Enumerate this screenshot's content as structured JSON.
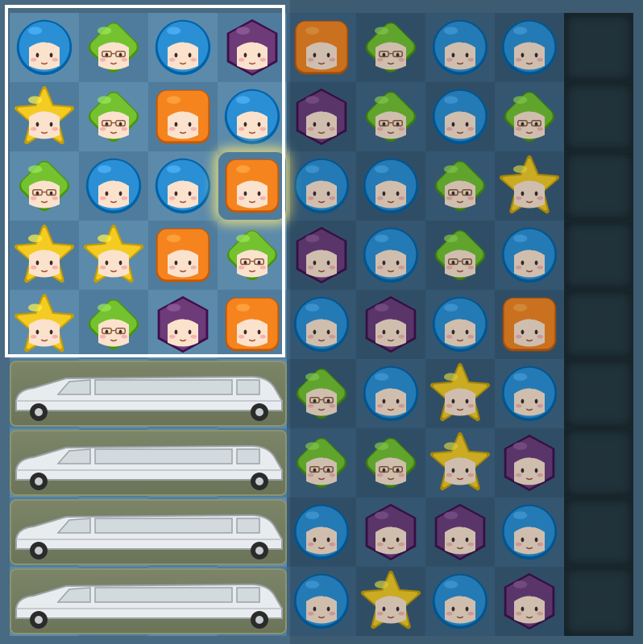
{
  "game": {
    "board": {
      "cols": 9,
      "rows": 9,
      "pieces": [
        [
          "blue",
          "green",
          "blue",
          "purple",
          "orange",
          "green",
          "blue",
          "blue",
          null
        ],
        [
          "yellow",
          "green",
          "orange",
          "blue",
          "purple",
          "green",
          "blue",
          "green",
          null
        ],
        [
          "green",
          "blue",
          "blue",
          "orange",
          "blue",
          "blue",
          "green",
          "yellow",
          null
        ],
        [
          "yellow",
          "yellow",
          "orange",
          "green",
          "purple",
          "blue",
          "green",
          "blue",
          null
        ],
        [
          "yellow",
          "green",
          "purple",
          "orange",
          "blue",
          "purple",
          "blue",
          "orange",
          null
        ],
        [
          null,
          null,
          null,
          null,
          "green",
          "blue",
          "yellow",
          "blue",
          null
        ],
        [
          null,
          null,
          null,
          null,
          "green",
          "green",
          "yellow",
          "purple",
          null
        ],
        [
          null,
          null,
          null,
          null,
          "blue",
          "purple",
          "purple",
          "blue",
          null
        ],
        [
          null,
          null,
          null,
          null,
          "blue",
          "yellow",
          "blue",
          "purple",
          null
        ]
      ],
      "highlighted_cell": {
        "row": 2,
        "col": 3
      },
      "blocked_column": 8
    },
    "limousines": [
      {
        "name": "limousine-1"
      },
      {
        "name": "limousine-2"
      },
      {
        "name": "limousine-3"
      },
      {
        "name": "limousine-4"
      }
    ],
    "colors": {
      "blue": "#2a8fd4",
      "green": "#74c22f",
      "orange": "#f5841f",
      "purple": "#6c3b78",
      "yellow": "#f4cb22",
      "frame": "#ffffff"
    },
    "icons": {
      "blue": "blue-round-face-icon",
      "green": "green-diamond-glasses-face-icon",
      "orange": "orange-square-face-icon",
      "purple": "purple-hexagon-face-icon",
      "yellow": "yellow-star-face-icon",
      "limousine": "limousine-icon"
    }
  }
}
